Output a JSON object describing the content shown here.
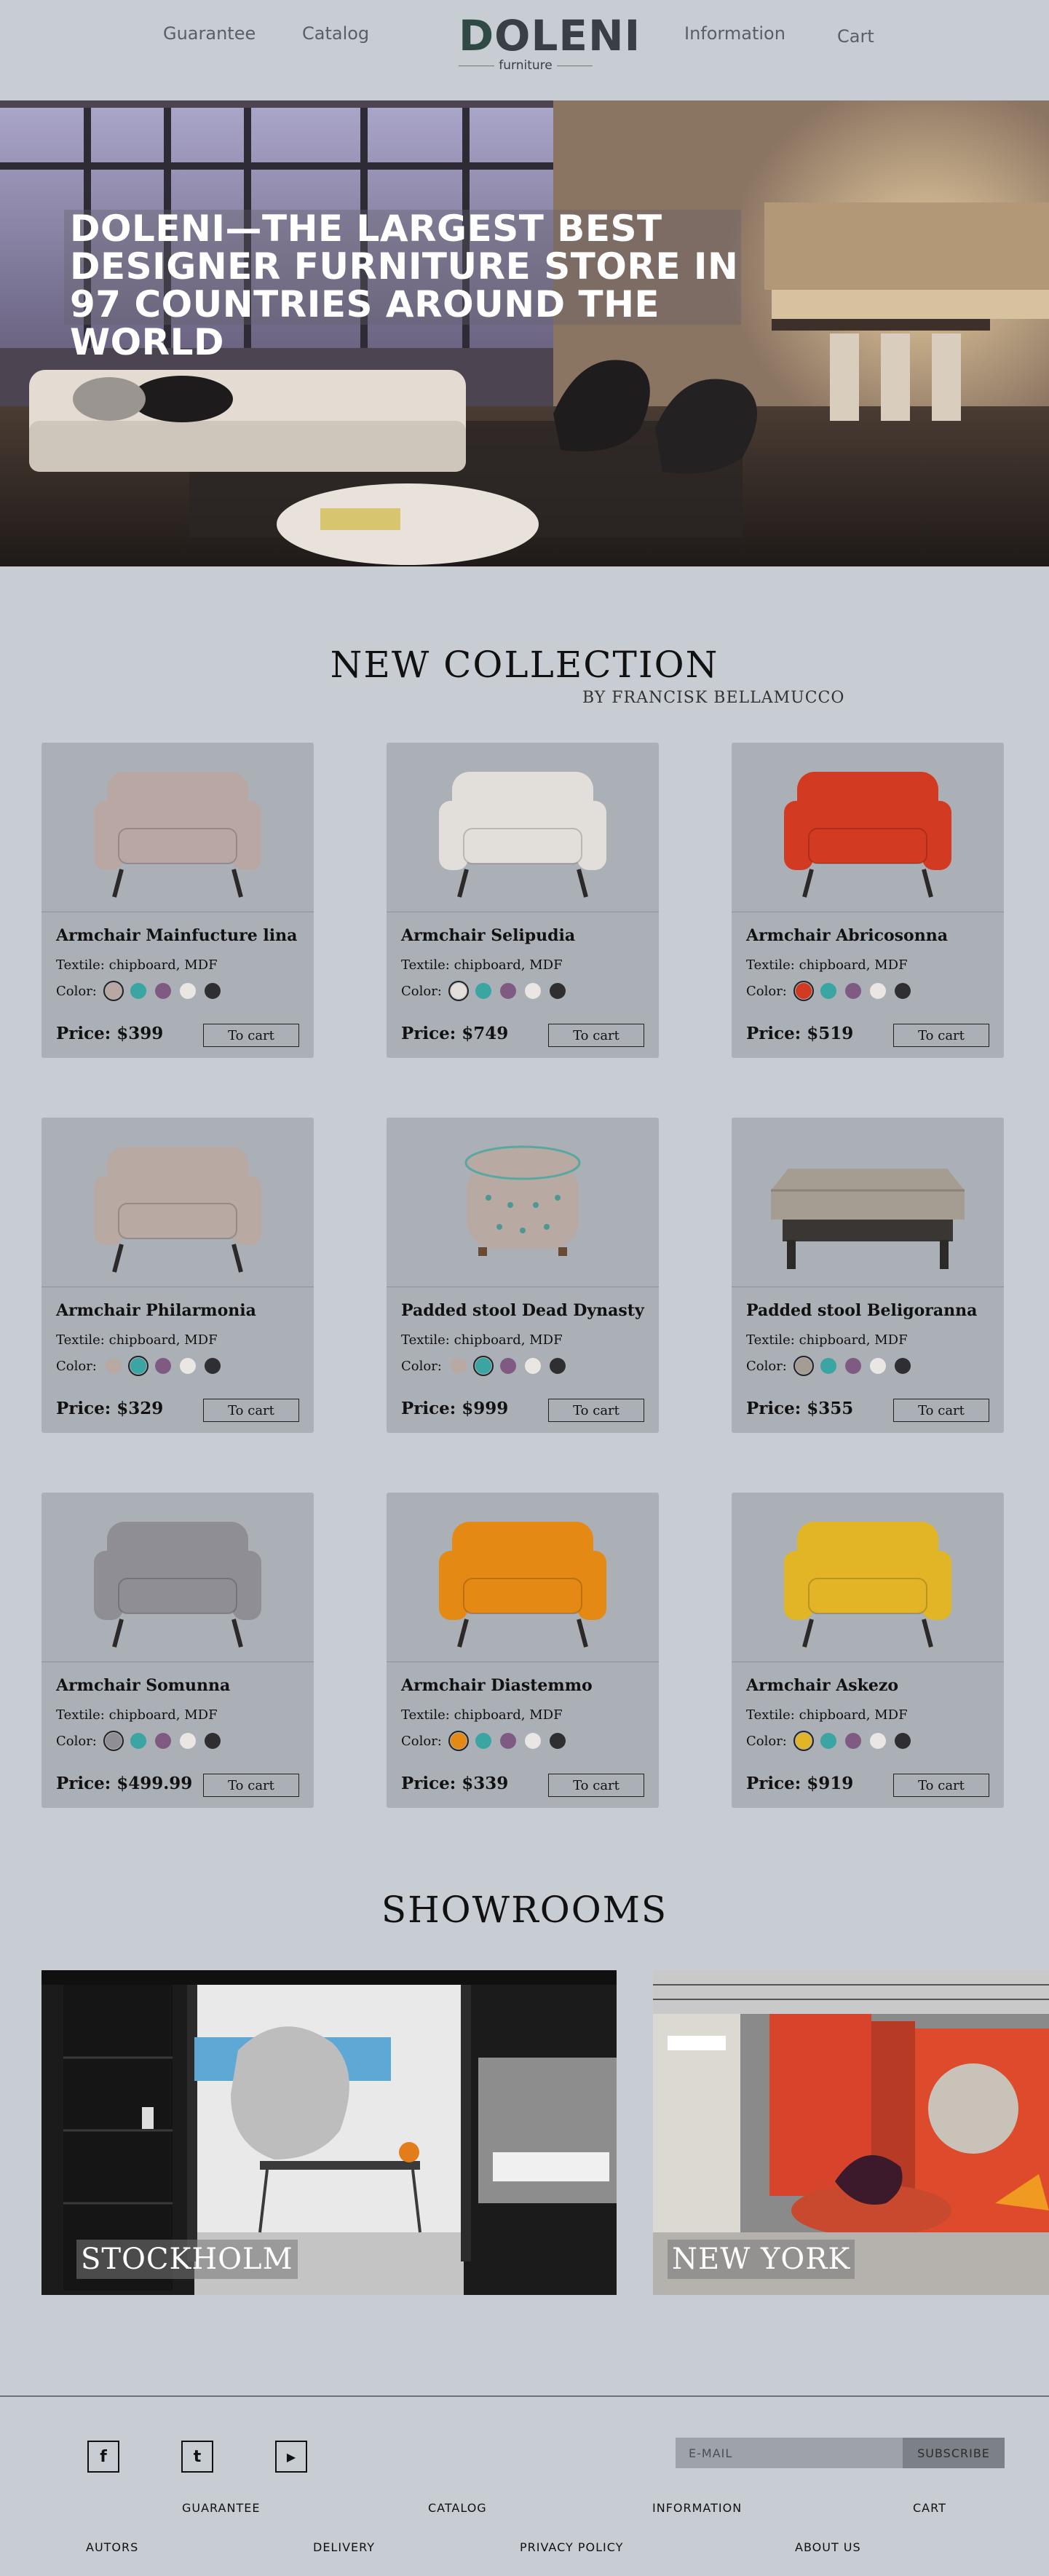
{
  "header": {
    "nav_left": [
      "Guarantee",
      "Catalog"
    ],
    "nav_right": [
      "Information",
      "Cart"
    ],
    "logo_main": "OLENI",
    "logo_main_first": "D",
    "logo_sub": "furniture"
  },
  "hero": {
    "title": "DOLENI—THE LARGEST BEST DESIGNER FURNITURE STORE IN 97 COUNTRIES AROUND THE WORLD"
  },
  "collection": {
    "title": "NEW COLLECTION",
    "byline": "BY FRANCISK BELLAMUCCO",
    "textile_label": "Textile: chipboard, MDF",
    "color_label": "Color:",
    "button_label": "To cart",
    "swatch_colors": [
      "#b8a9a3",
      "#3aa5a2",
      "#7f5b84",
      "#e9e6e3",
      "#2f2f31"
    ],
    "products": [
      {
        "name": "Armchair Mainfucture lina",
        "price": "Price: $399",
        "selected": 0,
        "first_color": "#b9a7a4",
        "icon": "armchair-icon"
      },
      {
        "name": "Armchair Selipudia",
        "price": "Price: $749",
        "selected": 0,
        "first_color": "#e2dfdb",
        "icon": "armchair-icon"
      },
      {
        "name": "Armchair Abricosonna",
        "price": "Price: $519",
        "selected": 0,
        "first_color": "#d23a22",
        "icon": "armchair-icon"
      },
      {
        "name": "Armchair Philarmonia",
        "price": "Price: $329",
        "selected": 1,
        "first_color": "#b8a9a3",
        "icon": "armchair-icon"
      },
      {
        "name": "Padded stool Dead Dynasty",
        "price": "Price: $999",
        "selected": 1,
        "first_color": "#b8a9a3",
        "icon": "stool-icon"
      },
      {
        "name": "Padded stool Beligoranna",
        "price": "Price: $355",
        "selected": 0,
        "first_color": "#a59c92",
        "icon": "ottoman-icon"
      },
      {
        "name": "Armchair Somunna",
        "price": "Price: $499.99",
        "selected": 0,
        "first_color": "#8f8e95",
        "icon": "armchair-icon"
      },
      {
        "name": "Armchair Diastemmo",
        "price": "Price: $339",
        "selected": 0,
        "first_color": "#e48a14",
        "icon": "armchair-icon"
      },
      {
        "name": "Armchair Askezo",
        "price": "Price: $919",
        "selected": 0,
        "first_color": "#e2b526",
        "icon": "armchair-icon"
      }
    ]
  },
  "showrooms": {
    "title": "SHOWROOMS",
    "items": [
      {
        "label": "STOCKHOLM"
      },
      {
        "label": "NEW YORK"
      }
    ]
  },
  "footer": {
    "social": [
      {
        "icon": "facebook-icon",
        "glyph": "f"
      },
      {
        "icon": "twitter-icon",
        "glyph": "t"
      },
      {
        "icon": "youtube-icon",
        "glyph": "▶"
      }
    ],
    "email_placeholder": "E-MAIL",
    "subscribe_label": "SUBSCRIBE",
    "links_row1": [
      "GUARANTEE",
      "CATALOG",
      "INFORMATION",
      "CART"
    ],
    "links_row2": [
      "AUTORS",
      "DELIVERY",
      "PRIVACY POLICY",
      "ABOUT US"
    ]
  }
}
